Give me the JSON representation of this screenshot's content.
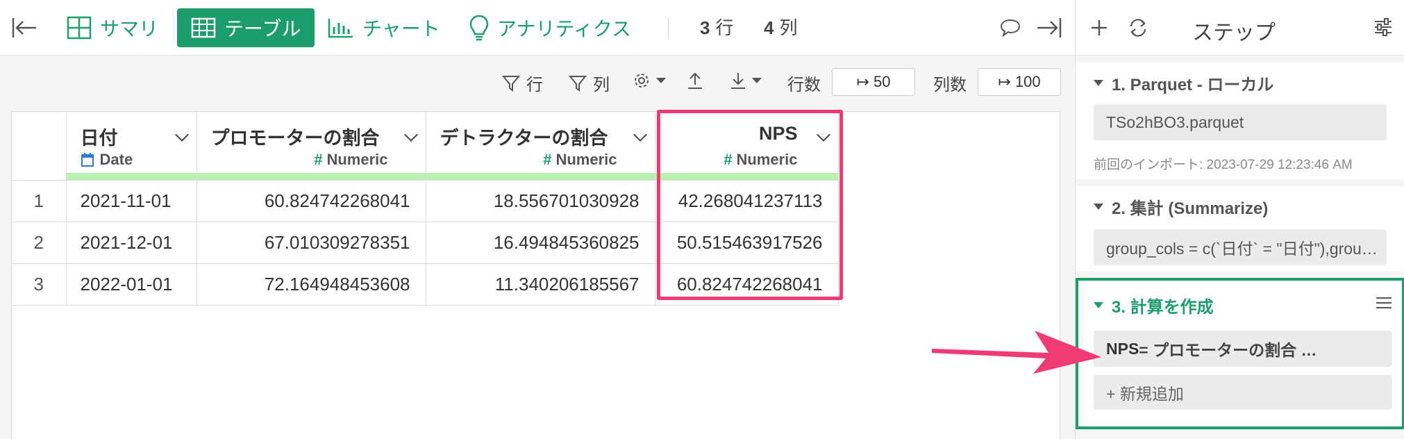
{
  "toolbar": {
    "summary_label": "サマリ",
    "table_label": "テーブル",
    "chart_label": "チャート",
    "analytics_label": "アナリティクス",
    "rows_value": "3",
    "rows_unit": "行",
    "cols_value": "4",
    "cols_unit": "列"
  },
  "subbar": {
    "row_filter_label": "行",
    "col_filter_label": "列",
    "row_count_label": "行数",
    "row_count_value": "↦ 50",
    "col_count_label": "列数",
    "col_count_value": "↦ 100"
  },
  "table": {
    "columns": [
      {
        "name": "日付",
        "type": "Date"
      },
      {
        "name": "プロモーターの割合",
        "type": "Numeric"
      },
      {
        "name": "デトラクターの割合",
        "type": "Numeric"
      },
      {
        "name": "NPS",
        "type": "Numeric"
      }
    ],
    "rows": [
      {
        "num": "1",
        "cells": [
          "2021-11-01",
          "60.824742268041",
          "18.556701030928",
          "42.268041237113"
        ]
      },
      {
        "num": "2",
        "cells": [
          "2021-12-01",
          "67.010309278351",
          "16.494845360825",
          "50.515463917526"
        ]
      },
      {
        "num": "3",
        "cells": [
          "2022-01-01",
          "72.164948453608",
          "11.340206185567",
          "60.824742268041"
        ]
      }
    ]
  },
  "panel": {
    "title": "ステップ",
    "steps": [
      {
        "title": "1. Parquet - ローカル",
        "box": "TSo2hBO3.parquet",
        "note": "前回のインポート: 2023-07-29 12:23:46 AM"
      },
      {
        "title": "2. 集計 (Summarize)",
        "box": "group_cols = c(`日付` = \"日付\"),grou…"
      },
      {
        "title": "3. 計算を作成",
        "box_bold": "NPS",
        "box_rest": " = プロモーターの割合 …",
        "add_label": "+ 新規追加"
      }
    ]
  },
  "colors": {
    "accent": "#1d9d6b",
    "highlight": "#ee3b74",
    "type_bar": "#b8f0b0"
  }
}
